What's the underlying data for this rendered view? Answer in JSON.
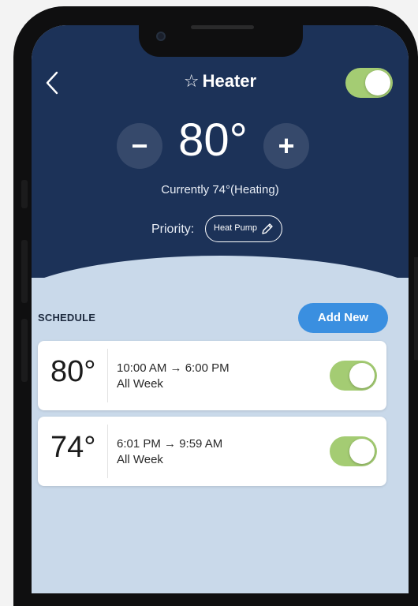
{
  "header": {
    "title": "Heater",
    "star_icon": "star-outline-icon",
    "back_icon": "chevron-left-icon",
    "power_on": true
  },
  "thermostat": {
    "minus_label": "−",
    "plus_label": "+",
    "setpoint": "80°",
    "current_status": "Currently 74°(Heating)",
    "priority_label": "Priority:",
    "priority_value": "Heat Pump"
  },
  "schedule": {
    "label": "SCHEDULE",
    "add_new_label": "Add New",
    "items": [
      {
        "temp": "80°",
        "time": "10:00 AM → 6:00 PM",
        "days": "All Week",
        "enabled": true
      },
      {
        "temp": "74°",
        "time": "6:01 PM → 9:59 AM",
        "days": "All Week",
        "enabled": true
      }
    ]
  },
  "colors": {
    "header_bg": "#1c3258",
    "content_bg": "#c9d9ea",
    "toggle_on": "#a4cc73",
    "accent": "#3a8fe0"
  }
}
